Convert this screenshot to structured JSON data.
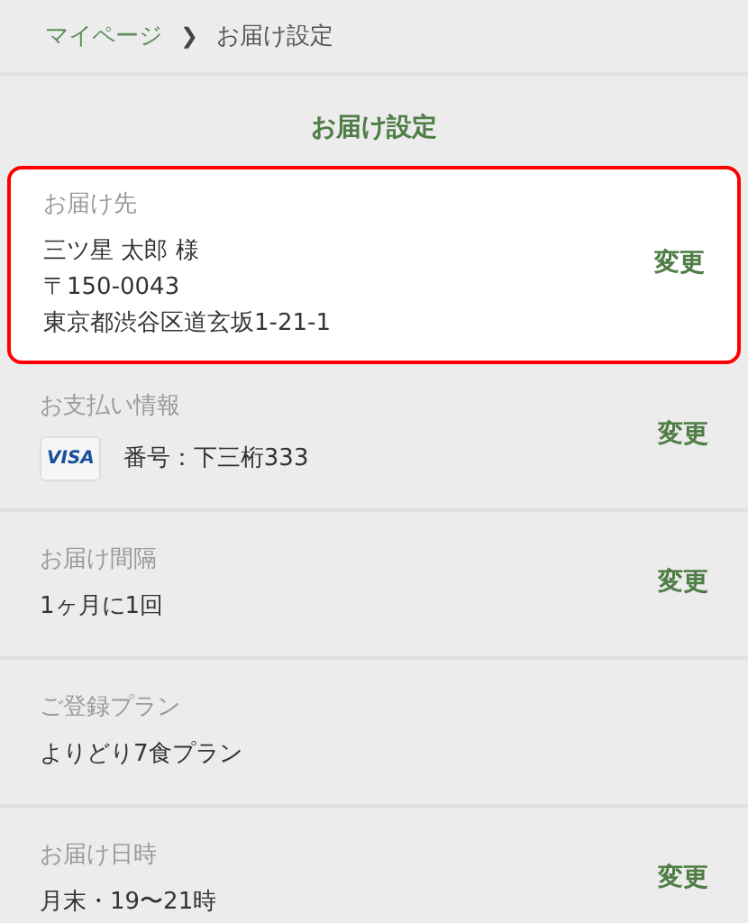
{
  "breadcrumb": {
    "items": [
      {
        "label": "マイページ",
        "kind": "link"
      },
      {
        "label": "お届け設定",
        "kind": "current"
      }
    ],
    "separator": "❯"
  },
  "title": "お届け設定",
  "sections": [
    {
      "label": "お届け先",
      "highlighted": true,
      "lines": [
        "三ツ星 太郎 様",
        "〒150-0043",
        "東京都渋谷区道玄坂1-21-1"
      ],
      "action": "変更"
    },
    {
      "label": "お支払い情報",
      "highlighted": false,
      "card_brand": "VISA",
      "lines": [
        "番号：下三桁333"
      ],
      "action": "変更"
    },
    {
      "label": "お届け間隔",
      "highlighted": false,
      "lines": [
        "1ヶ月に1回"
      ],
      "action": "変更"
    },
    {
      "label": "ご登録プラン",
      "highlighted": false,
      "lines": [
        "よりどり7食プラン"
      ]
    },
    {
      "label": "お届け日時",
      "highlighted": false,
      "lines": [
        "月末・19〜21時"
      ],
      "action": "変更"
    }
  ]
}
